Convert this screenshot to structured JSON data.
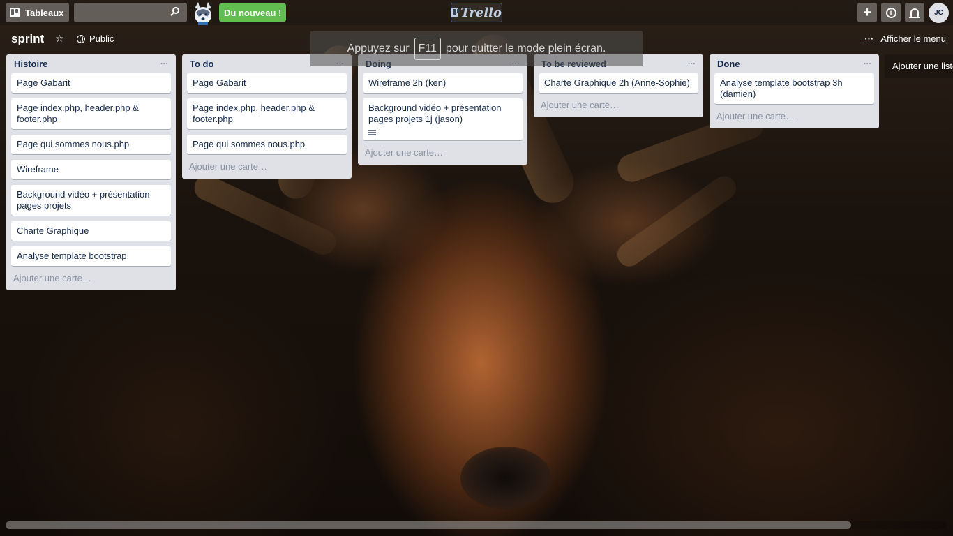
{
  "header": {
    "boards_label": "Tableaux",
    "search_value": "",
    "new_badge": "Du nouveau !",
    "logo_text": "Trello",
    "plus_label": "+",
    "info_label": "i",
    "avatar_initials": "JC"
  },
  "board": {
    "title": "sprint",
    "visibility": "Public",
    "menu_label": "Afficher le menu",
    "star_glyph": "☆",
    "menu_glyph": "···"
  },
  "toast": {
    "before": "Appuyez sur",
    "key": "F11",
    "after": "pour quitter le mode plein écran."
  },
  "lists": [
    {
      "title": "Histoire",
      "cards": [
        "Page Gabarit",
        "Page index.php, header.php & footer.php",
        "Page qui sommes nous.php",
        "Wireframe",
        "Background vidéo + présentation pages projets",
        "Charte Graphique",
        "Analyse template bootstrap"
      ]
    },
    {
      "title": "To do",
      "cards": [
        "Page Gabarit",
        "Page index.php, header.php & footer.php",
        "Page qui sommes nous.php"
      ]
    },
    {
      "title": "Doing",
      "cards": [
        "Wireframe 2h (ken)",
        "Background vidéo + présentation pages projets 1j (jason)"
      ]
    },
    {
      "title": "To be reviewed",
      "cards": [
        "Charte Graphique 2h (Anne-Sophie)"
      ]
    },
    {
      "title": "Done",
      "cards": [
        "Analyse template bootstrap 3h (damien)"
      ]
    }
  ],
  "list_menu_glyph": "···",
  "add_card_label": "Ajouter une carte…",
  "add_list_label": "Ajouter une liste…",
  "icons": {
    "boards": "boards-icon",
    "search": "search-icon",
    "mascot": "husky-mascot-icon",
    "plus": "plus-icon",
    "info": "info-icon",
    "bell": "bell-icon",
    "star": "star-icon",
    "globe": "globe-icon",
    "description": "description-icon"
  },
  "colors": {
    "new_badge": "#61bd4f",
    "list_bg": "#dfe1e6",
    "card_bg": "#ffffff"
  }
}
